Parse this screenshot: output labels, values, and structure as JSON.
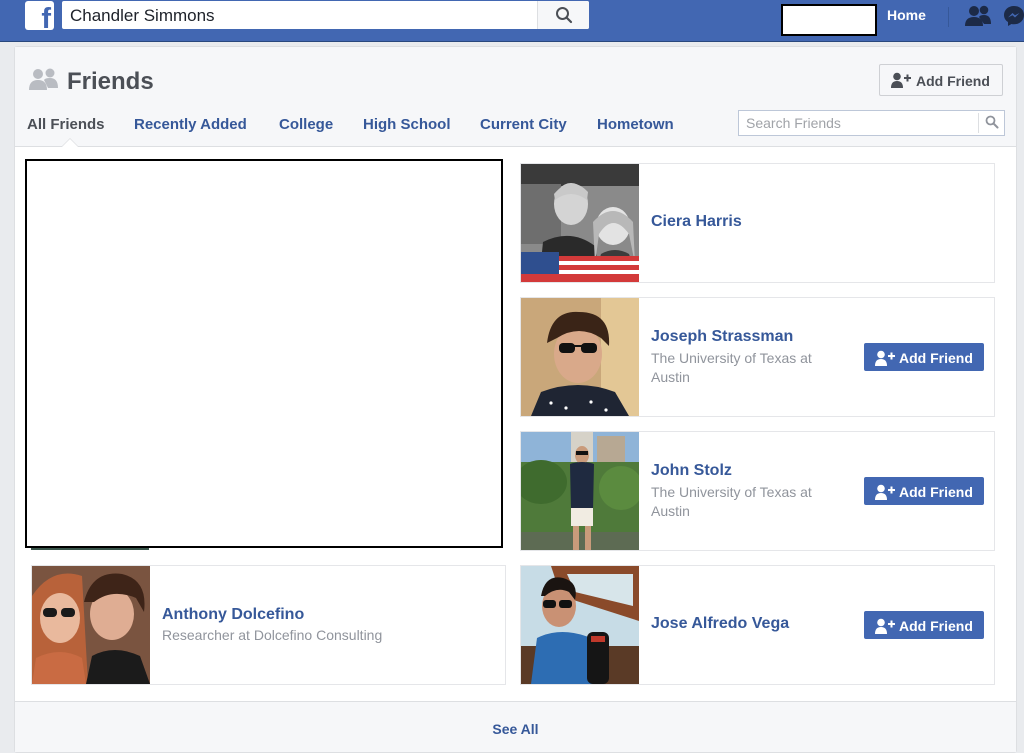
{
  "topbar": {
    "logo_letter": "f",
    "search_value": "Chandler Simmons",
    "home_label": "Home",
    "colors": {
      "bar": "#4267b2"
    },
    "icons": [
      "facebook-logo-icon",
      "search-icon",
      "friend-requests-icon",
      "messenger-icon"
    ]
  },
  "page": {
    "title": "Friends",
    "add_friend_label": "Add Friend",
    "tabs": [
      "All Friends",
      "Recently Added",
      "College",
      "High School",
      "Current City",
      "Hometown"
    ],
    "active_tab": "All Friends",
    "search_placeholder": "Search Friends",
    "see_all_label": "See All"
  },
  "friends": [
    {
      "name": "Ciera Harris",
      "line1": "",
      "line2": "",
      "button": ""
    },
    {
      "name": "Joseph Strassman",
      "line1": "The University of Texas at",
      "line2": "Austin",
      "button": "Add Friend"
    },
    {
      "name": "John Stolz",
      "line1": "The University of Texas at",
      "line2": "Austin",
      "button": "Add Friend"
    },
    {
      "name": "Jose Alfredo Vega",
      "line1": "",
      "line2": "",
      "button": "Add Friend"
    },
    {
      "name": "Anthony Dolcefino",
      "role": "Researcher",
      "at": "at",
      "org": "Dolcefino Consulting",
      "button": ""
    }
  ]
}
